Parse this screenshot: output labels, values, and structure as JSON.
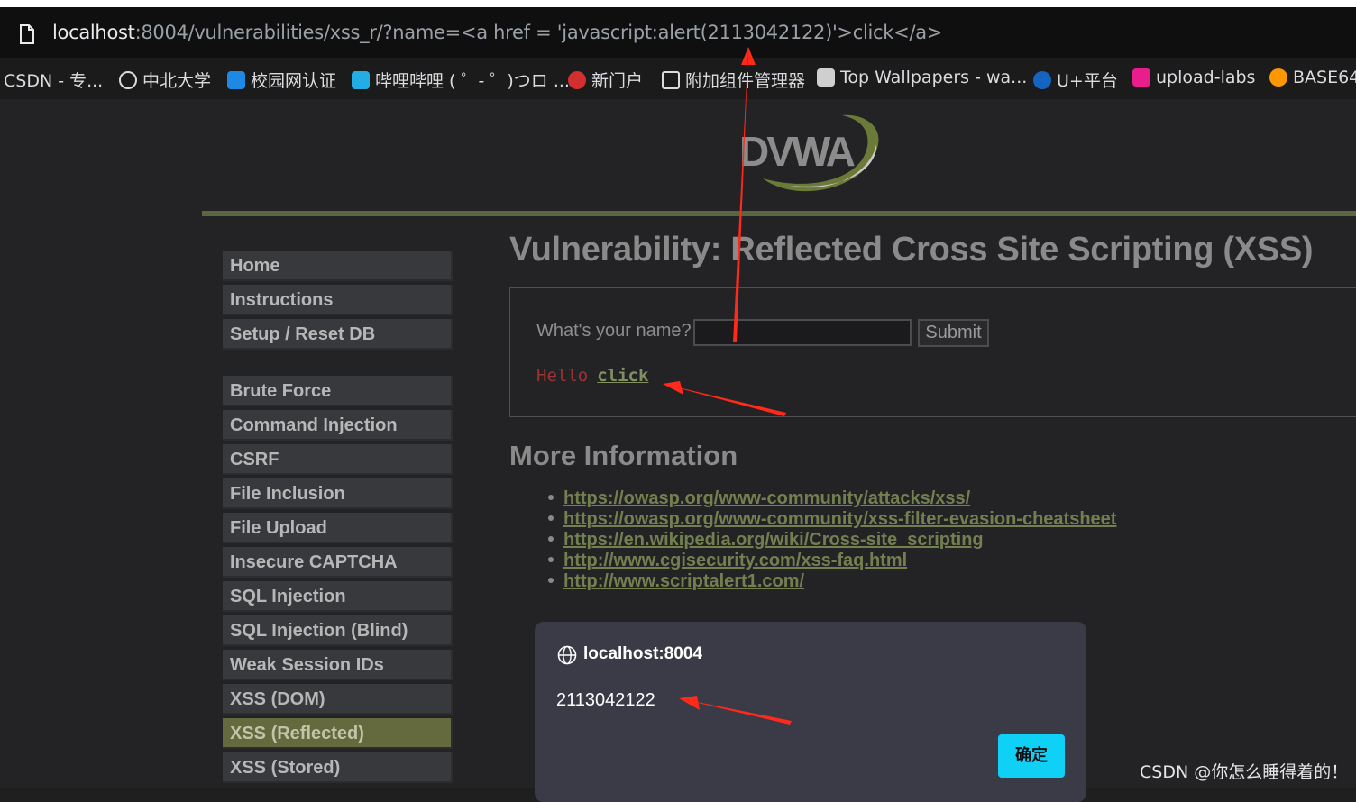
{
  "browser": {
    "url_host": "localhost",
    "url_rest": ":8004/vulnerabilities/xss_r/?name=<a href = 'javascript:alert(2113042122)'>click</a>",
    "bookmarks": [
      {
        "label": "CSDN - 专...",
        "icon": "csdn-icon",
        "color": "#1b1b1c"
      },
      {
        "label": "中北大学",
        "icon": "globe-icon",
        "color": "#1b1b1c"
      },
      {
        "label": "校园网认证",
        "icon": "portal-icon",
        "color": "#1e88e5"
      },
      {
        "label": "哔哩哔哩 ( ゜- ゜)つロ ...",
        "icon": "bilibili-icon",
        "color": "#23ade5"
      },
      {
        "label": "新门户",
        "icon": "school-icon",
        "color": "#d32f2f"
      },
      {
        "label": "附加组件管理器",
        "icon": "puzzle-icon",
        "color": "#1b1b1c"
      },
      {
        "label": "Top Wallpapers - wa...",
        "icon": "wallpaper-icon",
        "color": "#cfcfcf"
      },
      {
        "label": "U+平台",
        "icon": "uplus-icon",
        "color": "#1565c0"
      },
      {
        "label": "upload-labs",
        "icon": "upload-icon",
        "color": "#e91e8c"
      },
      {
        "label": "BASE64",
        "icon": "base64-icon",
        "color": "#ff9800"
      }
    ]
  },
  "dvwa": {
    "logo_text": "DVWA",
    "menu_group1": [
      "Home",
      "Instructions",
      "Setup / Reset DB"
    ],
    "menu_group2": [
      "Brute Force",
      "Command Injection",
      "CSRF",
      "File Inclusion",
      "File Upload",
      "Insecure CAPTCHA",
      "SQL Injection",
      "SQL Injection (Blind)",
      "Weak Session IDs",
      "XSS (DOM)",
      "XSS (Reflected)",
      "XSS (Stored)"
    ],
    "active_item": "XSS (Reflected)",
    "page_title": "Vulnerability: Reflected Cross Site Scripting (XSS)",
    "form": {
      "label": "What's your name?",
      "input_value": "",
      "submit_label": "Submit"
    },
    "hello_text": "Hello",
    "hello_link": "click",
    "more_info_title": "More Information",
    "links": [
      "https://owasp.org/www-community/attacks/xss/",
      "https://owasp.org/www-community/xss-filter-evasion-cheatsheet",
      "https://en.wikipedia.org/wiki/Cross-site_scripting",
      "http://www.cgisecurity.com/xss-faq.html",
      "http://www.scriptalert1.com/"
    ]
  },
  "alert_dialog": {
    "host": "localhost:8004",
    "message": "2113042122",
    "ok_label": "确定"
  },
  "watermark": "CSDN @你怎么睡得着的！",
  "colors": {
    "accent_green": "#5b6642",
    "active_menu": "#64693e",
    "link": "#747f50",
    "dialog_bg": "#3b3a47",
    "ok_button": "#0fd0f5",
    "annotation_arrow": "#ff2a1a"
  }
}
